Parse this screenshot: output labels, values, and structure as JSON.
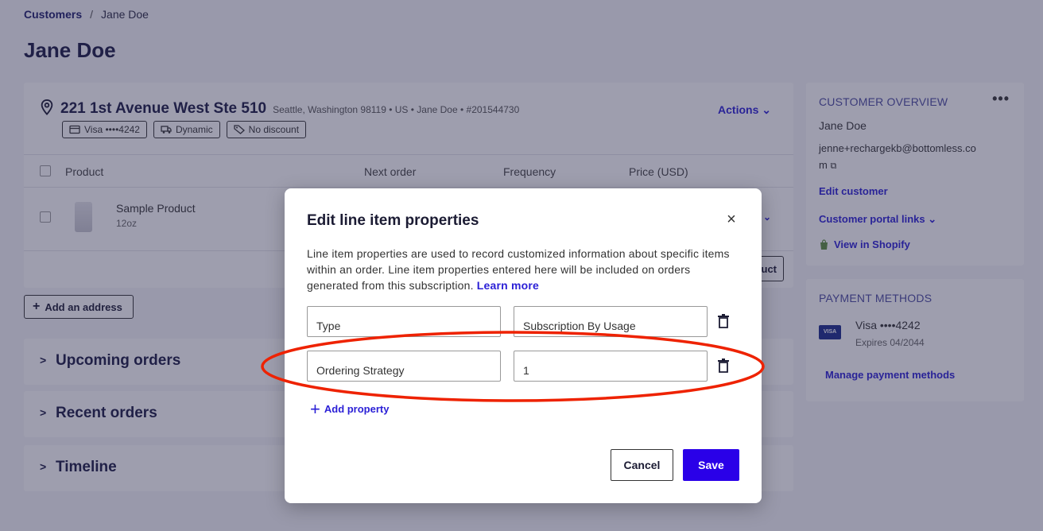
{
  "breadcrumb": {
    "parent": "Customers",
    "separator": "/",
    "current": "Jane Doe"
  },
  "page_title": "Jane Doe",
  "address": {
    "title": "221 1st Avenue West Ste 510",
    "meta": "Seattle, Washington 98119  •  US  •  Jane Doe  •  #201544730",
    "actions_label": "Actions",
    "chips": [
      {
        "icon": "credit-card-icon",
        "label": "Visa ••••4242"
      },
      {
        "icon": "truck-icon",
        "label": "Dynamic"
      },
      {
        "icon": "tag-icon",
        "label": "No discount"
      }
    ],
    "columns": {
      "product": "Product",
      "next_order": "Next order",
      "frequency": "Frequency",
      "price": "Price (USD)"
    },
    "line_item": {
      "name": "Sample Product",
      "size": "12oz"
    },
    "add_product_label": "Add product"
  },
  "add_address_label": "Add an address",
  "sections": [
    {
      "label": "Upcoming orders"
    },
    {
      "label": "Recent orders"
    },
    {
      "label": "Timeline"
    }
  ],
  "customer_overview": {
    "heading": "CUSTOMER OVERVIEW",
    "name": "Jane Doe",
    "email_line1": "jenne+rechargekb@bottomless.co",
    "email_line2": "m",
    "edit_customer": "Edit customer",
    "portal_links": "Customer portal links",
    "view_in_shopify": "View in Shopify"
  },
  "payment_methods": {
    "heading": "PAYMENT METHODS",
    "card_label": "Visa ••••4242",
    "expires": "Expires 04/2044",
    "manage": "Manage payment methods",
    "badge": "VISA"
  },
  "modal": {
    "title": "Edit line item properties",
    "description": "Line item properties are used to record customized information about specific items within an order. Line item properties entered here will be included on orders generated from this subscription.",
    "learn_more": "Learn more",
    "properties": [
      {
        "name": "Type",
        "value": "Subscription By Usage"
      },
      {
        "name": "Ordering Strategy",
        "value": "1"
      }
    ],
    "add_property": "Add property",
    "cancel": "Cancel",
    "save": "Save"
  },
  "colors": {
    "accent": "#2a00e8",
    "link": "#2a1fd6",
    "annotation": "#ee2200"
  }
}
